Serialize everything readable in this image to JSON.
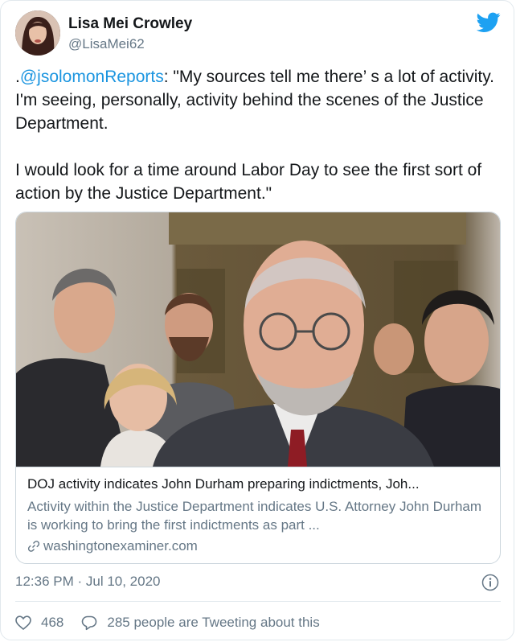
{
  "user": {
    "display_name": "Lisa Mei Crowley",
    "handle": "@LisaMei62"
  },
  "tweet": {
    "prefix": ".",
    "mention": "@jsolomonReports",
    "body": ": \"My sources tell me there’ s a lot of activity. I'm seeing, personally, activity behind the scenes of the Justice Department.\n\nI would look for a time around Labor Day to see the first sort of action by the Justice Department.\""
  },
  "card": {
    "title": "DOJ activity indicates John Durham preparing indictments, Joh...",
    "description": "Activity within the Justice Department indicates U.S. Attorney John Durham is working to bring the first indictments as part ...",
    "domain": "washingtonexaminer.com"
  },
  "timestamp": "12:36 PM · Jul 10, 2020",
  "actions": {
    "likes": "468",
    "conversation": "285 people are Tweeting about this"
  },
  "colors": {
    "accent": "#1b95e0",
    "secondary_text": "#657786",
    "border": "#e1e8ed"
  },
  "icons": [
    "twitter-bird-icon",
    "link-icon",
    "info-icon",
    "heart-icon",
    "reply-icon"
  ]
}
